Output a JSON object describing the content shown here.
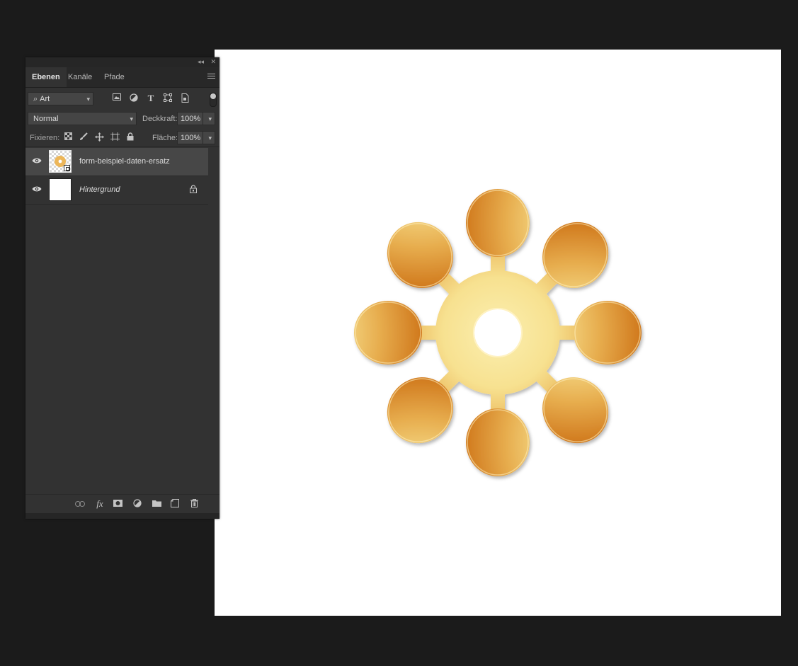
{
  "panel": {
    "tabs": [
      {
        "label": "Ebenen",
        "active": true
      },
      {
        "label": "Kanäle",
        "active": false
      },
      {
        "label": "Pfade",
        "active": false
      }
    ],
    "filter": {
      "selected": "Art"
    },
    "filter_icons": [
      "image-filter-icon",
      "adjustment-filter-icon",
      "type-filter-icon",
      "shape-filter-icon",
      "smart-object-filter-icon"
    ],
    "blend_mode": "Normal",
    "opacity_label": "Deckkraft:",
    "opacity_value": "100%",
    "lock_label": "Fixieren:",
    "fill_label": "Fläche:",
    "fill_value": "100%",
    "layers": [
      {
        "name": "form-beispiel-daten-ersatz",
        "visible": true,
        "selected": true,
        "type": "smart-object"
      },
      {
        "name": "Hintergrund",
        "visible": true,
        "selected": false,
        "locked": true,
        "type": "background"
      }
    ],
    "bottom_icons": [
      "link-icon",
      "fx-icon",
      "mask-icon",
      "adjustment-layer-icon",
      "group-folder-icon",
      "new-layer-icon",
      "trash-icon"
    ]
  },
  "canvas": {
    "background": "#ffffff",
    "shape": "gradient-flower",
    "colors": {
      "dark": "#d37c1c",
      "light": "#f8e79a"
    }
  },
  "colors": {
    "app_background": "#1b1b1b",
    "panel_background": "#323232",
    "selected_layer": "#474747"
  }
}
